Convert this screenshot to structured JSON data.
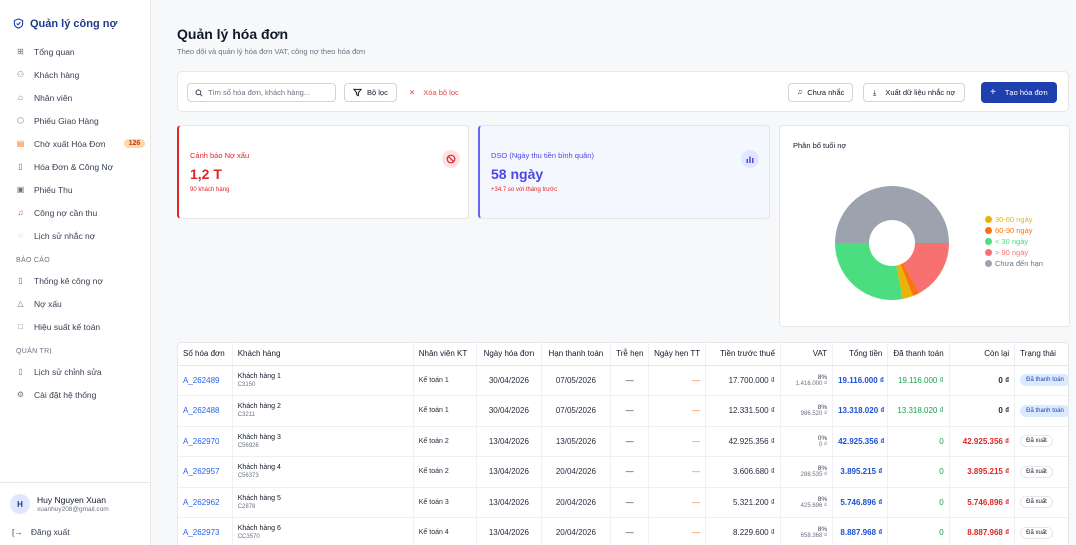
{
  "brand": "Quản lý công nợ",
  "nav": [
    {
      "label": "Tổng quan",
      "icon": "grid-icon"
    },
    {
      "label": "Khách hàng",
      "icon": "users-icon"
    },
    {
      "label": "Nhân viên",
      "icon": "building-icon"
    },
    {
      "label": "Phiếu Giao Hàng",
      "icon": "package-icon"
    },
    {
      "label": "Chờ xuất Hóa Đơn",
      "icon": "clipboard-icon",
      "badge": "126"
    },
    {
      "label": "Hóa Đơn & Công Nợ",
      "icon": "file-icon"
    },
    {
      "label": "Phiếu Thu",
      "icon": "receipt-icon"
    },
    {
      "label": "Công nợ cần thu",
      "icon": "bell-icon"
    },
    {
      "label": "Lịch sử nhắc nợ",
      "icon": "bell-outline-icon"
    }
  ],
  "report_section": {
    "label": "BÁO CÁO",
    "items": [
      {
        "label": "Thống kê công nợ",
        "icon": "file-icon"
      },
      {
        "label": "Nợ xấu",
        "icon": "warning-icon"
      },
      {
        "label": "Hiệu suất kế toán",
        "icon": "square-icon"
      }
    ]
  },
  "admin_section": {
    "label": "QUẢN TRỊ",
    "items": [
      {
        "label": "Lịch sử chỉnh sửa",
        "icon": "file-icon"
      },
      {
        "label": "Cài đặt hệ thống",
        "icon": "gear-icon"
      }
    ]
  },
  "user": {
    "initial": "H",
    "name": "Huy Nguyen Xuan",
    "email": "xuanhuy208@gmail.com",
    "logout": "Đăng xuất"
  },
  "page": {
    "title": "Quản lý hóa đơn",
    "subtitle": "Theo dõi và quản lý hóa đơn VAT, công nợ theo hóa đơn"
  },
  "toolbar": {
    "search_placeholder": "Tìm số hóa đơn, khách hàng...",
    "filter": "Bộ lọc",
    "clear_filter": "Xóa bộ lọc",
    "not_reminded": "Chưa nhắc",
    "export": "Xuất dữ liệu nhắc nợ",
    "create": "Tạo hóa đơn"
  },
  "cards": {
    "bad_debt": {
      "title": "Cảnh báo Nợ xấu",
      "value": "1,2 T",
      "note": "90 khách hàng"
    },
    "dso": {
      "title": "DSO (Ngày thu tiền bình quân)",
      "value": "58 ngày",
      "note": "+34.7 so với tháng trước"
    }
  },
  "chart_data": {
    "type": "pie",
    "title": "Phân bổ tuổi nợ",
    "slices": [
      {
        "name": "30-60 ngày",
        "value": 3,
        "color": "#eab308"
      },
      {
        "name": "60-90 ngày",
        "value": 2,
        "color": "#f97316"
      },
      {
        "name": "< 30 ngày",
        "value": 28,
        "color": "#4ade80"
      },
      {
        "name": "> 90 ngày",
        "value": 17,
        "color": "#f87171"
      },
      {
        "name": "Chưa đến hạn",
        "value": 50,
        "color": "#9ca3af"
      }
    ],
    "legend_placement": "right"
  },
  "table": {
    "headers": [
      "Số hóa đơn",
      "Khách hàng",
      "Nhân viên KT",
      "Ngày hóa đơn",
      "Hạn thanh toán",
      "Trễ hẹn",
      "Ngày hẹn TT",
      "Tiền trước thuế",
      "VAT",
      "Tổng tiền",
      "Đã thanh toán",
      "Còn lại",
      "Trạng thái"
    ],
    "rows": [
      {
        "inv": "A_262489",
        "cname": "Khách hàng 1",
        "ccode": "C3150",
        "staff": "Kế toán 1",
        "date": "30/04/2026",
        "due": "07/05/2026",
        "late": "—",
        "promise": "—",
        "pretax": "17.700.000 ₫",
        "vat_rate": "8%",
        "vat_amt": "1.416.000 ₫",
        "total": "19.116.000 ₫",
        "paid": "19.116.000 ₫",
        "remain": "0 ₫",
        "status": "Đã thanh toán"
      },
      {
        "inv": "A_262488",
        "cname": "Khách hàng 2",
        "ccode": "C3211",
        "staff": "Kế toán 1",
        "date": "30/04/2026",
        "due": "07/05/2026",
        "late": "—",
        "promise": "—",
        "pretax": "12.331.500 ₫",
        "vat_rate": "8%",
        "vat_amt": "986.520 ₫",
        "total": "13.318.020 ₫",
        "paid": "13.318.020 ₫",
        "remain": "0 ₫",
        "status": "Đã thanh toán"
      },
      {
        "inv": "A_262970",
        "cname": "Khách hàng 3",
        "ccode": "C56926",
        "staff": "Kế toán 2",
        "date": "13/04/2026",
        "due": "13/05/2026",
        "late": "—",
        "promise": "—",
        "pretax": "42.925.356 ₫",
        "vat_rate": "0%",
        "vat_amt": "0 ₫",
        "total": "42.925.356 ₫",
        "paid": "0",
        "remain": "42.925.356 ₫",
        "status": "Đã xuất"
      },
      {
        "inv": "A_262957",
        "cname": "Khách hàng 4",
        "ccode": "C56373",
        "staff": "Kế toán 2",
        "date": "13/04/2026",
        "due": "20/04/2026",
        "late": "—",
        "promise": "—",
        "pretax": "3.606.680 ₫",
        "vat_rate": "8%",
        "vat_amt": "288.535 ₫",
        "total": "3.895.215 ₫",
        "paid": "0",
        "remain": "3.895.215 ₫",
        "status": "Đã xuất"
      },
      {
        "inv": "A_262962",
        "cname": "Khách hàng 5",
        "ccode": "C2878",
        "staff": "Kế toán 3",
        "date": "13/04/2026",
        "due": "20/04/2026",
        "late": "—",
        "promise": "—",
        "pretax": "5.321.200 ₫",
        "vat_rate": "8%",
        "vat_amt": "425.696 ₫",
        "total": "5.746.896 ₫",
        "paid": "0",
        "remain": "5.746.896 ₫",
        "status": "Đã xuất"
      },
      {
        "inv": "A_262973",
        "cname": "Khách hàng 6",
        "ccode": "CC3570",
        "staff": "Kế toán 4",
        "date": "13/04/2026",
        "due": "20/04/2026",
        "late": "—",
        "promise": "—",
        "pretax": "8.229.600 ₫",
        "vat_rate": "8%",
        "vat_amt": "658.368 ₫",
        "total": "8.887.968 ₫",
        "paid": "0",
        "remain": "8.887.968 ₫",
        "status": "Đã xuất"
      }
    ]
  }
}
